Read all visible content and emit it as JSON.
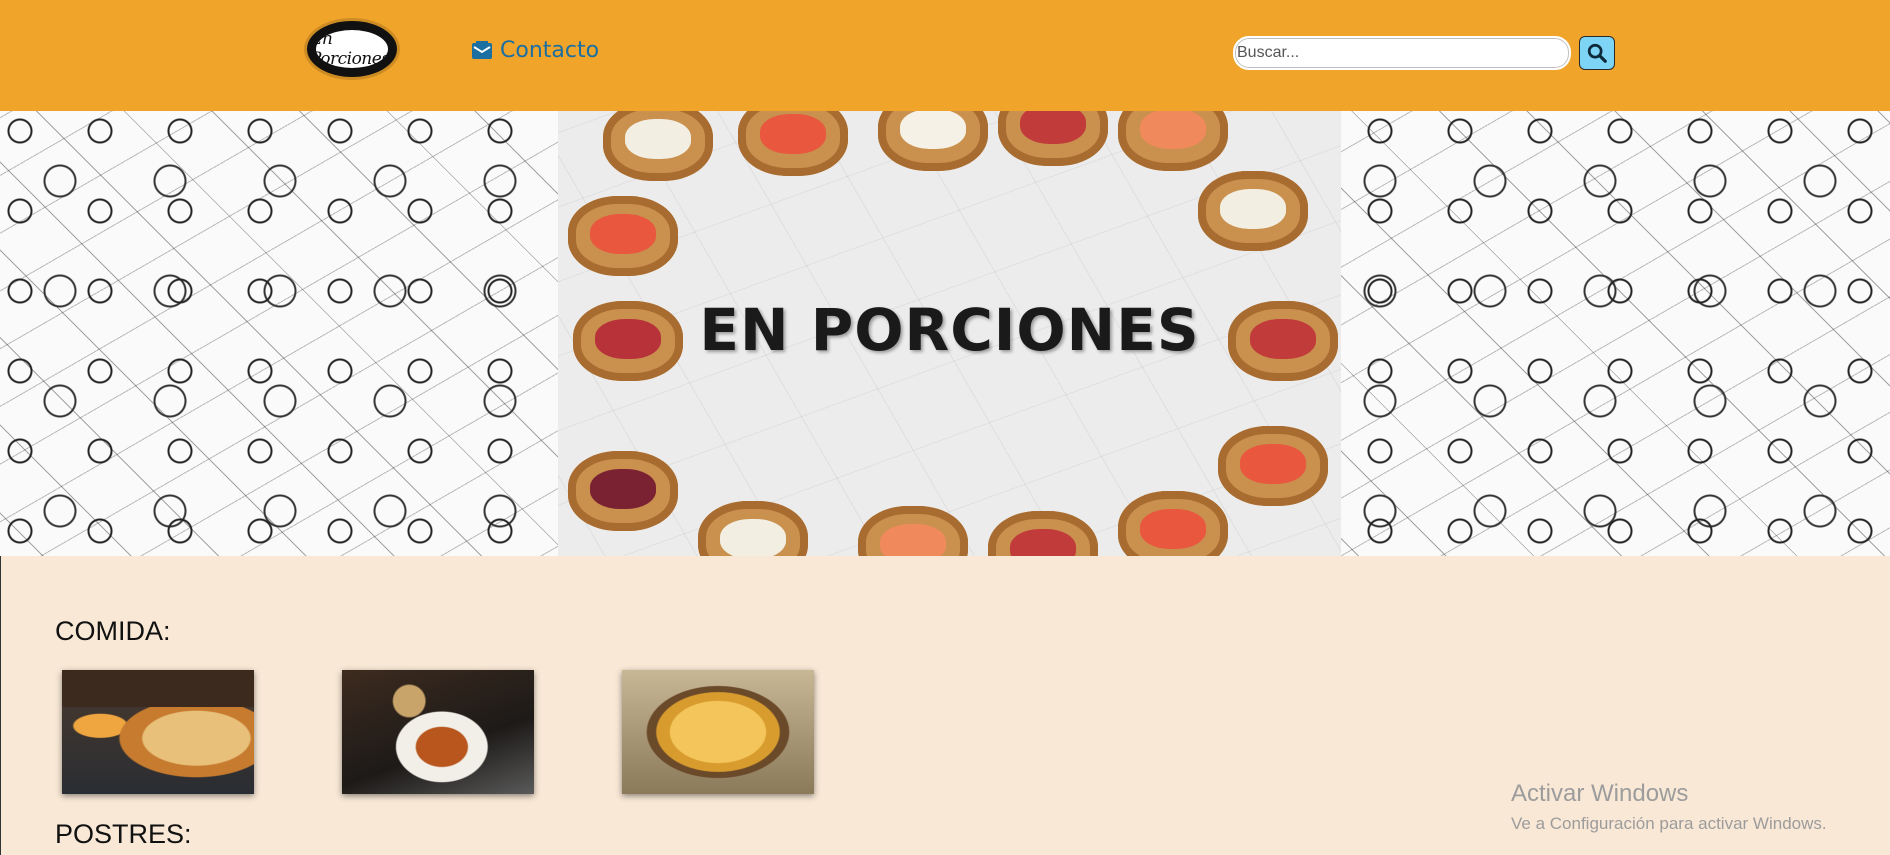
{
  "header": {
    "logo_text": "En Porciones",
    "contact_label": "Contacto",
    "search": {
      "placeholder": "Buscar...",
      "value": ""
    }
  },
  "hero": {
    "title": "EN PORCIONES"
  },
  "main": {
    "sections": [
      {
        "title": "COMIDA:"
      },
      {
        "title": "POSTRES:"
      }
    ]
  },
  "watermark": {
    "title": "Activar Windows",
    "subtitle": "Ve a Configuración para activar Windows."
  },
  "colors": {
    "header_bg": "#f0a42a",
    "page_bg": "#f9e8d6",
    "link": "#1b6fa1",
    "search_button": "#7dd4f5"
  }
}
